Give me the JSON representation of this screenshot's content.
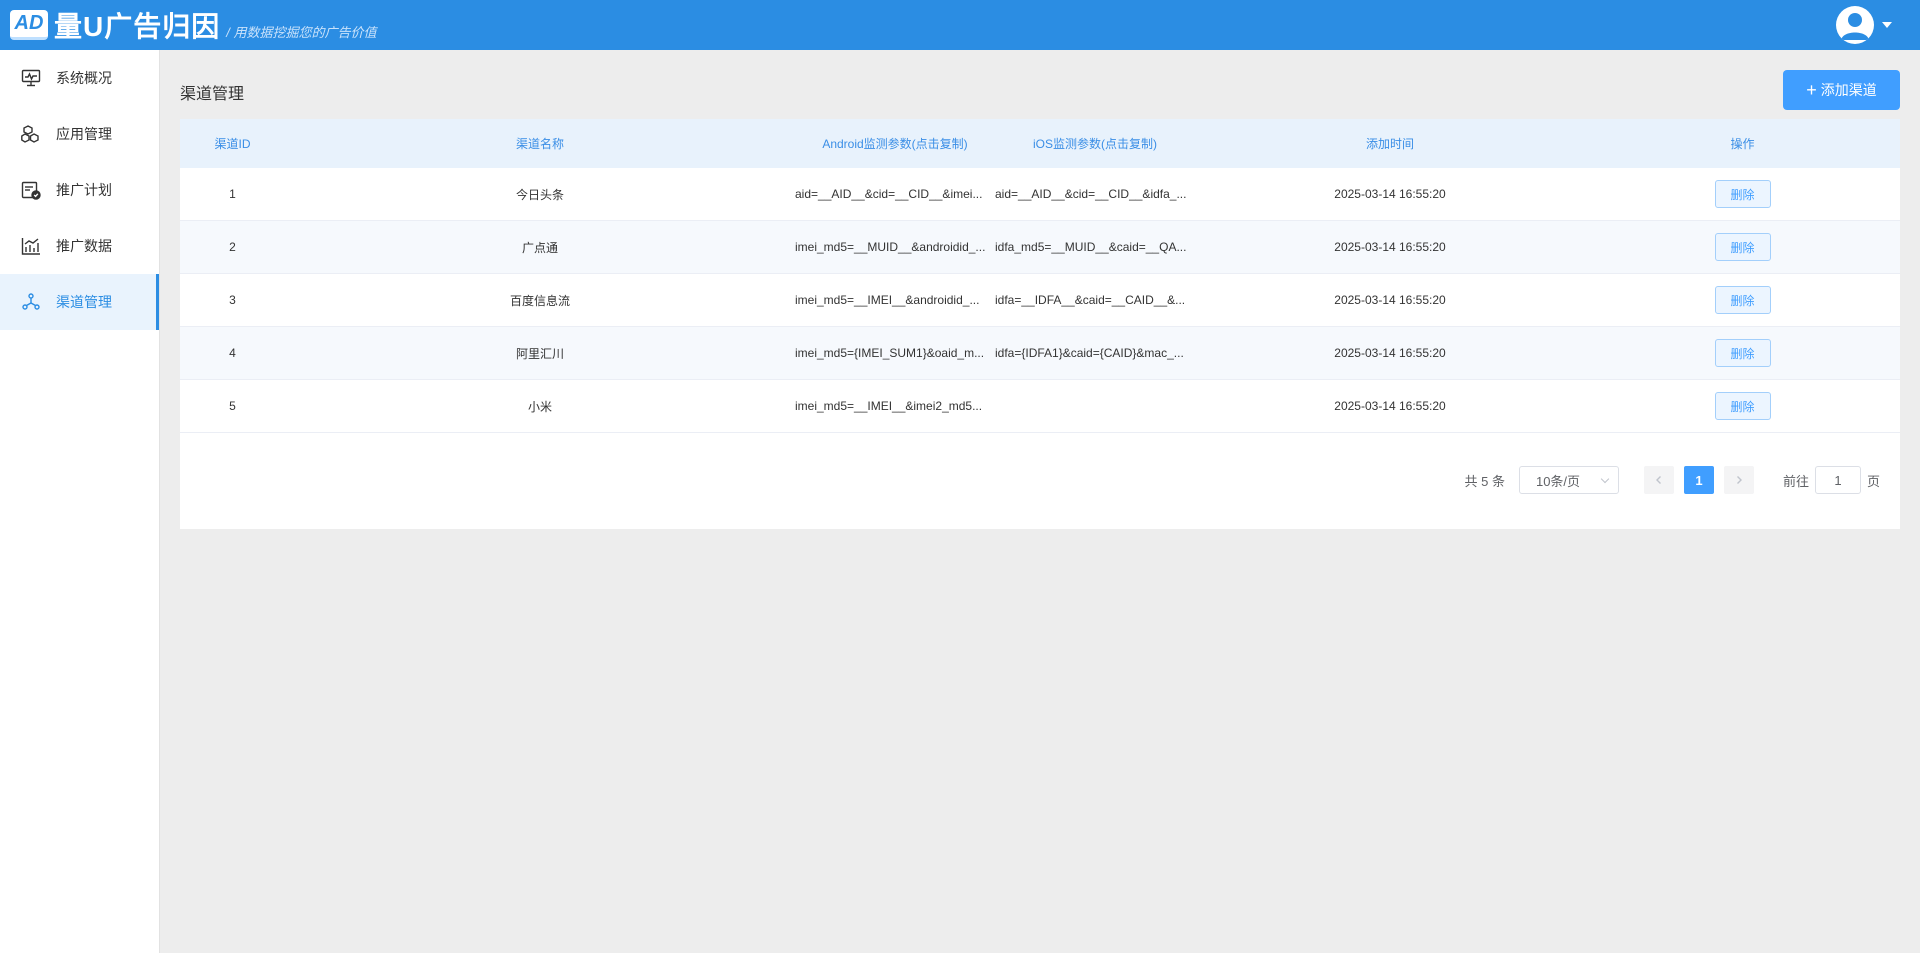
{
  "header": {
    "logo_badge": "AD",
    "logo_text": "量U广告归因",
    "slogan": "/ 用数据挖掘您的广告价值",
    "avatar_icon": "user-icon"
  },
  "sidebar": {
    "items": [
      {
        "label": "系统概况",
        "icon": "monitor-icon"
      },
      {
        "label": "应用管理",
        "icon": "cubes-icon"
      },
      {
        "label": "推广计划",
        "icon": "calendar-check-icon"
      },
      {
        "label": "推广数据",
        "icon": "bar-chart-icon"
      },
      {
        "label": "渠道管理",
        "icon": "share-icon",
        "active": true
      }
    ]
  },
  "main": {
    "title": "渠道管理",
    "add_button": "添加渠道",
    "table": {
      "headers": {
        "id": "渠道ID",
        "name": "渠道名称",
        "android": "Android监测参数(点击复制)",
        "ios": "iOS监测参数(点击复制)",
        "time": "添加时间",
        "op": "操作"
      },
      "rows": [
        {
          "id": "1",
          "name": "今日头条",
          "android": "aid=__AID__&cid=__CID__&imei...",
          "ios": "aid=__AID__&cid=__CID__&idfa_...",
          "time": "2025-03-14 16:55:20",
          "op": "删除"
        },
        {
          "id": "2",
          "name": "广点通",
          "android": "imei_md5=__MUID__&androidid_...",
          "ios": "idfa_md5=__MUID__&caid=__QA...",
          "time": "2025-03-14 16:55:20",
          "op": "删除"
        },
        {
          "id": "3",
          "name": "百度信息流",
          "android": "imei_md5=__IMEI__&androidid_...",
          "ios": "idfa=__IDFA__&caid=__CAID__&...",
          "time": "2025-03-14 16:55:20",
          "op": "删除"
        },
        {
          "id": "4",
          "name": "阿里汇川",
          "android": "imei_md5={IMEI_SUM1}&oaid_m...",
          "ios": "idfa={IDFA1}&caid={CAID}&mac_...",
          "time": "2025-03-14 16:55:20",
          "op": "删除"
        },
        {
          "id": "5",
          "name": "小米",
          "android": "imei_md5=__IMEI__&imei2_md5...",
          "ios": "",
          "time": "2025-03-14 16:55:20",
          "op": "删除"
        }
      ]
    },
    "pagination": {
      "total": "共 5 条",
      "page_size": "10条/页",
      "current_page": "1",
      "goto_prefix": "前往",
      "goto_value": "1",
      "goto_suffix": "页"
    }
  },
  "colors": {
    "header": "#2b8de3",
    "primary": "#409eff",
    "table_header": "#e8f2fc"
  }
}
